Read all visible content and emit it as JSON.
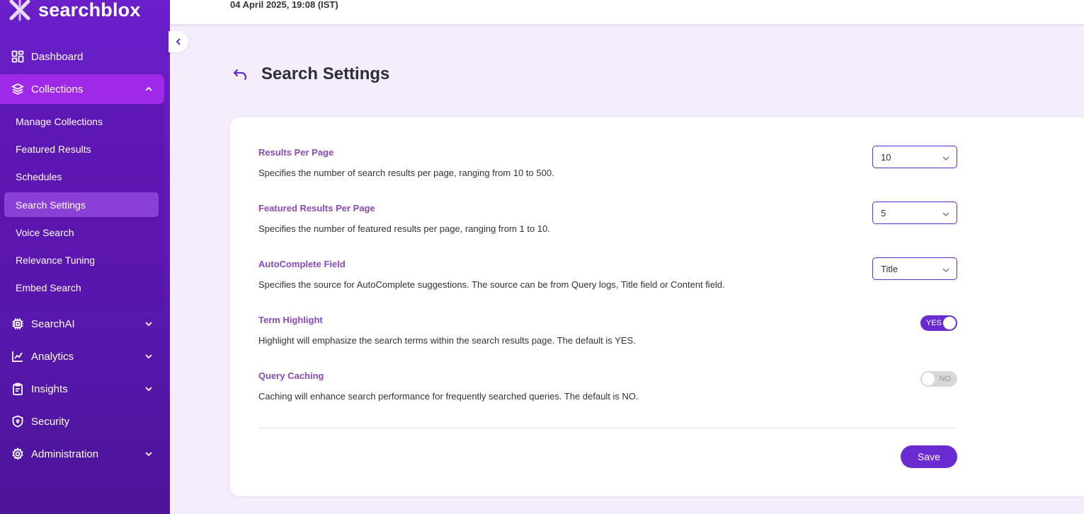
{
  "brand": {
    "name": "searchblox"
  },
  "topbar": {
    "timestamp": "04 April 2025, 19:08 (IST)"
  },
  "sidebar": {
    "items": [
      {
        "label": "Dashboard",
        "icon": "dashboard-icon"
      },
      {
        "label": "Collections",
        "icon": "layers-icon",
        "expanded": true,
        "active": true
      },
      {
        "label": "SearchAI",
        "icon": "chip-icon"
      },
      {
        "label": "Analytics",
        "icon": "chart-icon"
      },
      {
        "label": "Insights",
        "icon": "clipboard-icon"
      },
      {
        "label": "Security",
        "icon": "shield-icon"
      },
      {
        "label": "Administration",
        "icon": "gear-icon"
      }
    ],
    "collections_sub": [
      {
        "label": "Manage Collections"
      },
      {
        "label": "Featured Results"
      },
      {
        "label": "Schedules"
      },
      {
        "label": "Search Settings",
        "active": true
      },
      {
        "label": "Voice Search"
      },
      {
        "label": "Relevance Tuning"
      },
      {
        "label": "Embed Search"
      }
    ]
  },
  "page": {
    "title": "Search Settings"
  },
  "settings": [
    {
      "label": "Results Per Page",
      "desc": "Specifies the number of search results per page, ranging from 10 to 500.",
      "control": "select",
      "value": "10"
    },
    {
      "label": "Featured Results Per Page",
      "desc": "Specifies the number of featured results per page, ranging from 1 to 10.",
      "control": "select",
      "value": "5"
    },
    {
      "label": "AutoComplete Field",
      "desc": "Specifies the source for AutoComplete suggestions. The source can be from Query logs, Title field or Content field.",
      "control": "select",
      "value": "Title"
    },
    {
      "label": "Term Highlight",
      "desc": "Highlight will emphasize the search terms within the search results page. The default is YES.",
      "control": "toggle",
      "value": "YES",
      "on": true
    },
    {
      "label": "Query Caching",
      "desc": "Caching will enhance search performance for frequently searched queries. The default is NO.",
      "control": "toggle",
      "value": "NO",
      "on": false
    }
  ],
  "actions": {
    "save_label": "Save"
  },
  "colors": {
    "accent": "#6a2bd0",
    "sidebar": "#5b19b5",
    "active_nav": "#a028e8",
    "label": "#8a4ab8"
  }
}
